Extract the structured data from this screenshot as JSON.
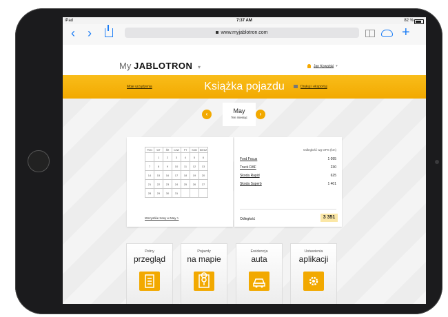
{
  "status_bar": {
    "device": "iPad",
    "time": "7:37 AM",
    "battery": "82 %"
  },
  "browser": {
    "url": "www.myjablotron.com"
  },
  "header": {
    "logo_prefix": "My",
    "logo_name": "JABLOTRON",
    "user_name": "Jan Kowalski"
  },
  "orange_bar": {
    "left_link": "Moje urządzenia",
    "title": "Książka pojazdu",
    "right_link": "Drukuj i eksportuj"
  },
  "month": {
    "name": "May",
    "subtitle": "Ten miesiąc"
  },
  "calendar": {
    "headers": [
      "PON",
      "WT",
      "ŚR",
      "CZW",
      "PT",
      "SOB",
      "NIEDZ"
    ],
    "rows": [
      [
        "",
        "1",
        "2",
        "3",
        "4",
        "5",
        "6"
      ],
      [
        "7",
        "8",
        "9",
        "10",
        "11",
        "12",
        "13"
      ],
      [
        "14",
        "15",
        "16",
        "17",
        "18",
        "19",
        "20"
      ],
      [
        "21",
        "22",
        "23",
        "24",
        "25",
        "26",
        "27"
      ],
      [
        "28",
        "29",
        "30",
        "31",
        "",
        "",
        ""
      ]
    ],
    "link": "Wszystkie trasy w May >"
  },
  "distances": {
    "header": "Odległość wg GPS (km)",
    "items": [
      {
        "name": "Ford Focus",
        "value": "1 095"
      },
      {
        "name": "Truck DAF",
        "value": "230"
      },
      {
        "name": "Skoda Rapid",
        "value": "625"
      },
      {
        "name": "Skoda Superb",
        "value": "1 401"
      }
    ],
    "total_label": "Odległość",
    "total_value": "3 351"
  },
  "tiles": [
    {
      "sub": "Pełny",
      "title": "przegląd",
      "icon": "list-icon"
    },
    {
      "sub": "Pojazdy",
      "title": "na mapie",
      "icon": "map-pin-icon"
    },
    {
      "sub": "Ewidencja",
      "title": "auta",
      "icon": "car-icon"
    },
    {
      "sub": "Ustawienia",
      "title": "aplikacji",
      "icon": "gear-icon"
    }
  ],
  "colors": {
    "accent": "#f2a900",
    "ios_blue": "#1a7cf5"
  }
}
